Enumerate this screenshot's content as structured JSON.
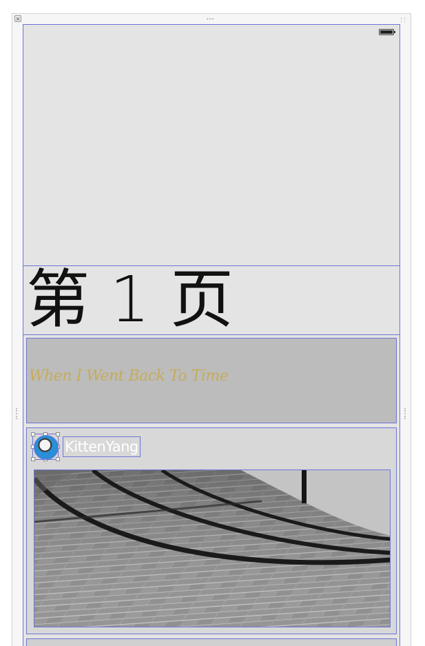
{
  "page": {
    "title": "第 1 页",
    "banner_text": "When I Went Back To Time",
    "author": {
      "name": "KittenYang"
    }
  },
  "status_bar": {
    "battery_icon": "battery-full-icon"
  },
  "colors": {
    "selection_outline": "#6d74d6",
    "banner_text": "#c7a94a",
    "screen_bg": "#e4e4e4"
  }
}
